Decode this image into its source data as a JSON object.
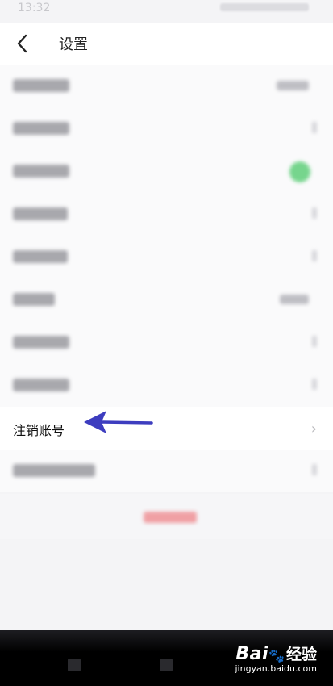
{
  "status_bar": {
    "time": "13:32"
  },
  "header": {
    "title": "设置"
  },
  "settings": {
    "highlighted_item": {
      "label": "注销账号"
    },
    "chevron": "›"
  },
  "watermark": {
    "brand": "Bai",
    "brand_suffix": "经验",
    "url": "jingyan.baidu.com"
  },
  "colors": {
    "toggle_on": "#5fcf7a",
    "arrow": "#3d3dbf",
    "logout": "#e0353d"
  }
}
